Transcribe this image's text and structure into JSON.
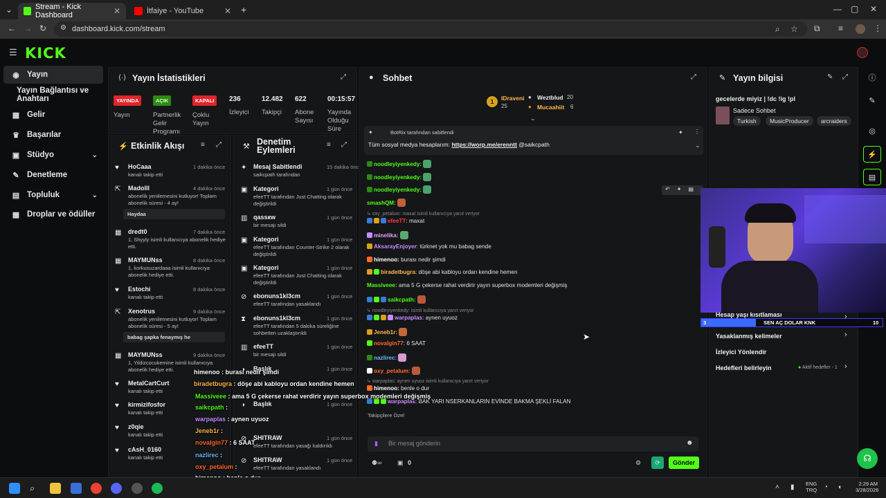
{
  "browser": {
    "tabs": [
      {
        "label": "Stream - Kick Dashboard",
        "active": true
      },
      {
        "label": "İtfaiye - YouTube",
        "active": false
      }
    ],
    "url": "dashboard.kick.com/stream"
  },
  "sidebar": {
    "items": [
      {
        "label": "Yayın",
        "icon": "broadcast-icon"
      },
      {
        "label": "Yayın Bağlantısı ve Anahtarı",
        "icon": ""
      },
      {
        "label": "Gelir",
        "icon": "dollar-icon"
      },
      {
        "label": "Başarılar",
        "icon": "trophy-icon"
      },
      {
        "label": "Stüdyo",
        "icon": "studio-icon"
      },
      {
        "label": "Denetleme",
        "icon": "wrench-icon"
      },
      {
        "label": "Topluluk",
        "icon": "community-icon"
      },
      {
        "label": "Droplar ve ödüller",
        "icon": "gift-icon"
      }
    ]
  },
  "stats": {
    "title": "Yayın İstatistikleri",
    "pills": [
      "YAYINDA",
      "AÇIK",
      "KAPALI"
    ],
    "pill_labels": [
      "Yayın",
      "Partnerlik Gelir Programı",
      "Çoklu Yayın"
    ],
    "numbers": [
      "236",
      "12.482",
      "622",
      "00:15:57"
    ],
    "number_labels": [
      "İzleyici",
      "Takipçi",
      "Abone Sayısı",
      "Yayında Olduğu Süre"
    ]
  },
  "activity": {
    "title": "Etkinlik Akışı",
    "items": [
      {
        "name": "HoCaaa",
        "sub": "kanalı takip etti",
        "time": "1 dakika önce"
      },
      {
        "name": "Madolll",
        "sub": "abonelik yenilemesini kutluyor! Toplam abonelik süresi - 4 ay!",
        "time": "4 dakika önce",
        "box": "Haydaa"
      },
      {
        "name": "dredt0",
        "sub": "1, Shyyly isimli kullanıcıya abonelik hediye etti.",
        "time": "7 dakika önce"
      },
      {
        "name": "MAYMUNss",
        "sub": "1, korkusuzardaaa isimli kullanıcıya abonelik hediye etti.",
        "time": "8 dakika önce"
      },
      {
        "name": "Estochi",
        "sub": "kanalı takip etti",
        "time": "8 dakika önce"
      },
      {
        "name": "Xenotrus",
        "sub": "abonelik yenilemesini kutluyor! Toplam abonelik süresi - 5 ay!",
        "time": "9 dakika önce",
        "box": "babag şapka fenaymış he"
      },
      {
        "name": "MAYMUNss",
        "sub": "1, Yildizcocukemine isimli kullanıcıya abonelik hediye etti.",
        "time": "9 dakika önce"
      },
      {
        "name": "MetalCartCurt",
        "sub": "kanalı takip etti",
        "time": ""
      },
      {
        "name": "kirmizifosfor",
        "sub": "kanalı takip etti",
        "time": ""
      },
      {
        "name": "z0qie",
        "sub": "kanalı takip etti",
        "time": ""
      },
      {
        "name": "cAsH_0160",
        "sub": "kanalı takip etti",
        "time": ""
      }
    ]
  },
  "moderation": {
    "title": "Denetim Eylemleri",
    "items": [
      {
        "name": "Mesaj Sabitlendi",
        "sub": "saikcpath tarafından",
        "time": "15 dakika önce"
      },
      {
        "name": "Kategori",
        "sub": "efeeTT tarafından Just Chatting olarak değiştirildi",
        "time": "1 gün önce"
      },
      {
        "name": "qassкw",
        "sub": "bir mesajı sildi",
        "time": "1 gün önce"
      },
      {
        "name": "Kategori",
        "sub": "efeeTT tarafından Counter-Strike 2 olarak değiştirildi",
        "time": "1 gün önce"
      },
      {
        "name": "Kategori",
        "sub": "efeeTT tarafından Just Chatting olarak değiştirildi",
        "time": "1 gün önce"
      },
      {
        "name": "ebonuns1kl3cm",
        "sub": "efeeTT tarafından yasaklandı",
        "time": "1 gün önce"
      },
      {
        "name": "ebonuns1kl3cm",
        "sub": "efeeTT tarafından 5 dakika süreliğine sohbetten uzaklaştırıldı",
        "time": "1 gün önce"
      },
      {
        "name": "efeeTT",
        "sub": "bir mesajı sildi",
        "time": "1 gün önce"
      },
      {
        "name": "Başlık",
        "sub": "",
        "time": "1 gün önce"
      },
      {
        "name": "Başlık",
        "sub": "",
        "time": "1 gün önce"
      },
      {
        "name": "SHITRAW",
        "sub": "efeeTT tarafından yasağı kaldırıldı",
        "time": "1 gün önce"
      },
      {
        "name": "SHITRAW",
        "sub": "efeeTT tarafından yasaklandı",
        "time": "1 gün önce"
      }
    ]
  },
  "chat": {
    "title": "Sohbet",
    "leaders": [
      {
        "name": "IDraveni",
        "count": "25"
      },
      {
        "name": "Weztblud",
        "count": "20"
      },
      {
        "name": "Mucaahiit",
        "count": "6"
      }
    ],
    "pinned": {
      "by": "BotRix tarafından sabitlendi",
      "text": "Tüm sosyal medya hesaplarım: ",
      "link": "https://worp.me/erenntt",
      "mention": " @saikcpath"
    },
    "messages": [
      {
        "user": "noodleyiyenkedy:",
        "text": "",
        "color": "#53fc18"
      },
      {
        "user": "noodleyiyenkedy:",
        "text": "",
        "color": "#53fc18"
      },
      {
        "user": "noodleyiyenkedy:",
        "text": "",
        "color": "#53fc18"
      },
      {
        "user": "smashQM:",
        "text": "",
        "color": "#53fc18"
      },
      {
        "user": "efeeTT",
        "text": ": maxat",
        "color": "#ff3a3a",
        "reply": "oxy_petalum: maxat isimli kullanıcıya yanıt veriyor"
      },
      {
        "user": "minelika:",
        "text": "",
        "color": "#e6a0ff"
      },
      {
        "user": "AksarayEnjoyer",
        "text": ": türknet yok mu babag sende",
        "color": "#c88cff"
      },
      {
        "user": "himenoo:",
        "text": " burası nedir şimdi",
        "color": "#ffffff"
      },
      {
        "user": "biradetbugra",
        "text": ": döşe abi kabloyu ordan kendine hemen",
        "color": "#ffb84a"
      },
      {
        "user": "Massiveee:",
        "text": " ama 5 G çekerse rahat verdirir yayın superbox modemleri değişmiş",
        "color": "#53fc18"
      },
      {
        "user": "saikcpath:",
        "text": "",
        "color": "#53fc18"
      },
      {
        "user": "warpaplas",
        "text": ": aynen uyuoz",
        "color": "#c88cff",
        "reply": "noodleyiyenkedy: isimli kullanıcıya yanıt veriyor"
      },
      {
        "user": "Jeneb1r:",
        "text": "",
        "color": "#ffb84a"
      },
      {
        "user": "novalgin77",
        "text": ": 6 SAAT",
        "color": "#ff6a2a"
      },
      {
        "user": "nazlirec:",
        "text": "",
        "color": "#6fb6ff"
      },
      {
        "user": "oxy_petalum:",
        "text": "",
        "color": "#ff6a2a"
      },
      {
        "user": "himenoo:",
        "text": " benle o dur",
        "color": "#ffffff",
        "reply": "warpaplas: aynen uyuoz isimli kullanıcıya yanıt veriyor"
      },
      {
        "user": "warpaplas",
        "text": ": BAK YARI NSERKANLARIN EVİNDE BAKMA ŞEKLİ FALAN",
        "color": "#c88cff"
      }
    ],
    "followers_only": "Takipçilere Özel",
    "input_placeholder": "Bir mesaj gönderin",
    "viewer_zero": "0",
    "send_label": "Gönder"
  },
  "overlay": {
    "title": "SEN AÇ DOLAR KNK",
    "left_num": "3",
    "right_num": "10",
    "chat": [
      {
        "user": "himenoo",
        "text": " : burası nedir şimdi"
      },
      {
        "user": "biradetbugra",
        "text": " : döşe abi kabloyu ordan kendine hemen"
      },
      {
        "user": "Massiveee",
        "text": " : ama 5 G çekerse rahat verdirir yayın superbox modemleri değişmiş"
      },
      {
        "user": "saikcpath",
        "text": " :"
      },
      {
        "user": "warpaplas",
        "text": " : aynen uyuoz"
      },
      {
        "user": "Jeneb1r",
        "text": " :"
      },
      {
        "user": "novalgin77",
        "text": " : 6 SAAT"
      },
      {
        "user": "nazlirec",
        "text": " :"
      },
      {
        "user": "oxy_petalum",
        "text": " :"
      },
      {
        "user": "himenoo",
        "text": " : benle o dur"
      },
      {
        "user": "warpaplas",
        "text": " : BAK YARI NSERKANLARIN EVİNDE BAKMA ŞEKLİ FALAN"
      }
    ]
  },
  "info": {
    "title": "Yayın bilgisi",
    "stream_title": "gecelerde miyiz | !dc !ig !pl",
    "category": "Sadece Sohbet",
    "tags": [
      "Turkish",
      "MusicProducer",
      "arcraiders"
    ],
    "rows": [
      "Hesap yaşı kısıtlaması",
      "Yasaklanmış kelimeler",
      "İzleyici Yönlendir",
      "Hedefleri belirleyin"
    ],
    "goal_badge": "Aktif hedefler - 1"
  },
  "taskbar": {
    "lang": "ENG",
    "lang2": "TRQ",
    "time": "2:29 AM",
    "date": "3/28/2026"
  },
  "colors": {
    "kick_green": "#53fc18",
    "live_red": "#e0242b",
    "panel_bg": "#141618"
  }
}
